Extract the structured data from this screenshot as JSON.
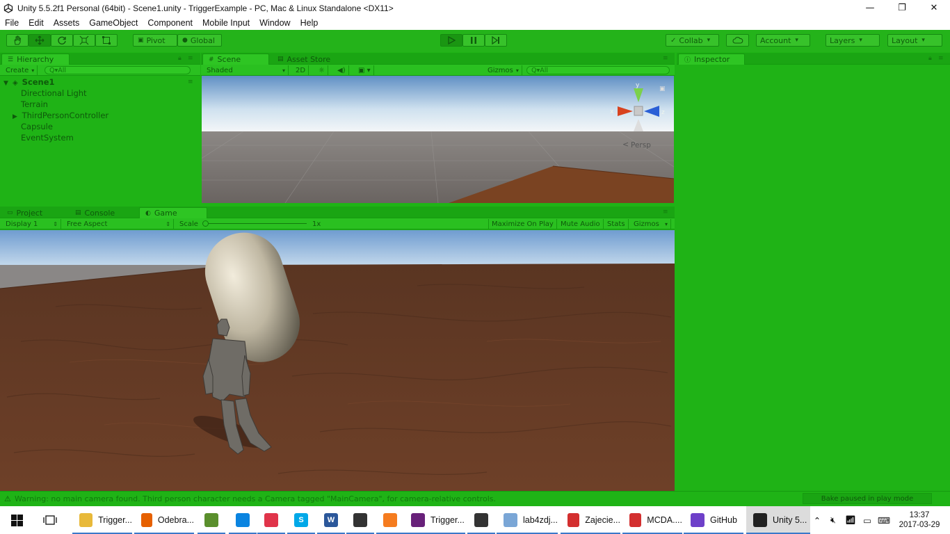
{
  "window": {
    "title": "Unity 5.5.2f1 Personal (64bit) - Scene1.unity - TriggerExample - PC, Mac & Linux Standalone <DX11>",
    "minimize": "—",
    "maximize": "❐",
    "close": "✕"
  },
  "menu": [
    "File",
    "Edit",
    "Assets",
    "GameObject",
    "Component",
    "Mobile Input",
    "Window",
    "Help"
  ],
  "toolbar": {
    "pivot": "Pivot",
    "global": "Global",
    "collab": "Collab",
    "account": "Account",
    "layers": "Layers",
    "layout": "Layout"
  },
  "hierarchy": {
    "tab": "Hierarchy",
    "create": "Create",
    "search_placeholder": "Q▾All",
    "scene": "Scene1",
    "items": [
      "Directional Light",
      "Terrain",
      "ThirdPersonController",
      "Capsule",
      "EventSystem"
    ]
  },
  "scene": {
    "tab": "Scene",
    "asset_store_tab": "Asset Store",
    "shading": "Shaded",
    "mode2d": "2D",
    "gizmos": "Gizmos",
    "search_placeholder": "Q▾All",
    "persp": "Persp",
    "axis_y": "y",
    "axis_x": "x",
    "axis_z": "z"
  },
  "game": {
    "project_tab": "Project",
    "console_tab": "Console",
    "tab": "Game",
    "display": "Display 1",
    "aspect": "Free Aspect",
    "scale_label": "Scale",
    "scale_value": "1x",
    "maximize": "Maximize On Play",
    "mute": "Mute Audio",
    "stats": "Stats",
    "gizmos": "Gizmos"
  },
  "inspector": {
    "tab": "Inspector"
  },
  "status": {
    "warning": "Warning: no main camera found. Third person character needs a Camera tagged \"MainCamera\", for camera-relative controls.",
    "bake": "Bake paused in play mode"
  },
  "taskbar": {
    "items": [
      {
        "label": "Trigger...",
        "color": "#e8b93a",
        "glyph": ""
      },
      {
        "label": "Odebra...",
        "color": "#e66000",
        "glyph": ""
      },
      {
        "label": "",
        "color": "#5a8f2d",
        "glyph": ""
      },
      {
        "label": "",
        "color": "#0a84e0",
        "glyph": ""
      },
      {
        "label": "",
        "color": "#e0344a",
        "glyph": ""
      },
      {
        "label": "",
        "color": "#00a8e8",
        "glyph": "S"
      },
      {
        "label": "",
        "color": "#2b579a",
        "glyph": "W"
      },
      {
        "label": "",
        "color": "#333333",
        "glyph": ""
      },
      {
        "label": "",
        "color": "#f57c1f",
        "glyph": ""
      },
      {
        "label": "Trigger...",
        "color": "#68217a",
        "glyph": ""
      },
      {
        "label": "",
        "color": "#333333",
        "glyph": ""
      },
      {
        "label": "lab4zdj...",
        "color": "#7aa6d6",
        "glyph": ""
      },
      {
        "label": "Zajecie...",
        "color": "#d32f2f",
        "glyph": ""
      },
      {
        "label": "MCDA....",
        "color": "#d32f2f",
        "glyph": ""
      },
      {
        "label": "GitHub",
        "color": "#6e40c9",
        "glyph": ""
      },
      {
        "label": "Unity 5...",
        "color": "#222222",
        "glyph": ""
      }
    ],
    "time": "13:37",
    "date": "2017-03-29"
  }
}
